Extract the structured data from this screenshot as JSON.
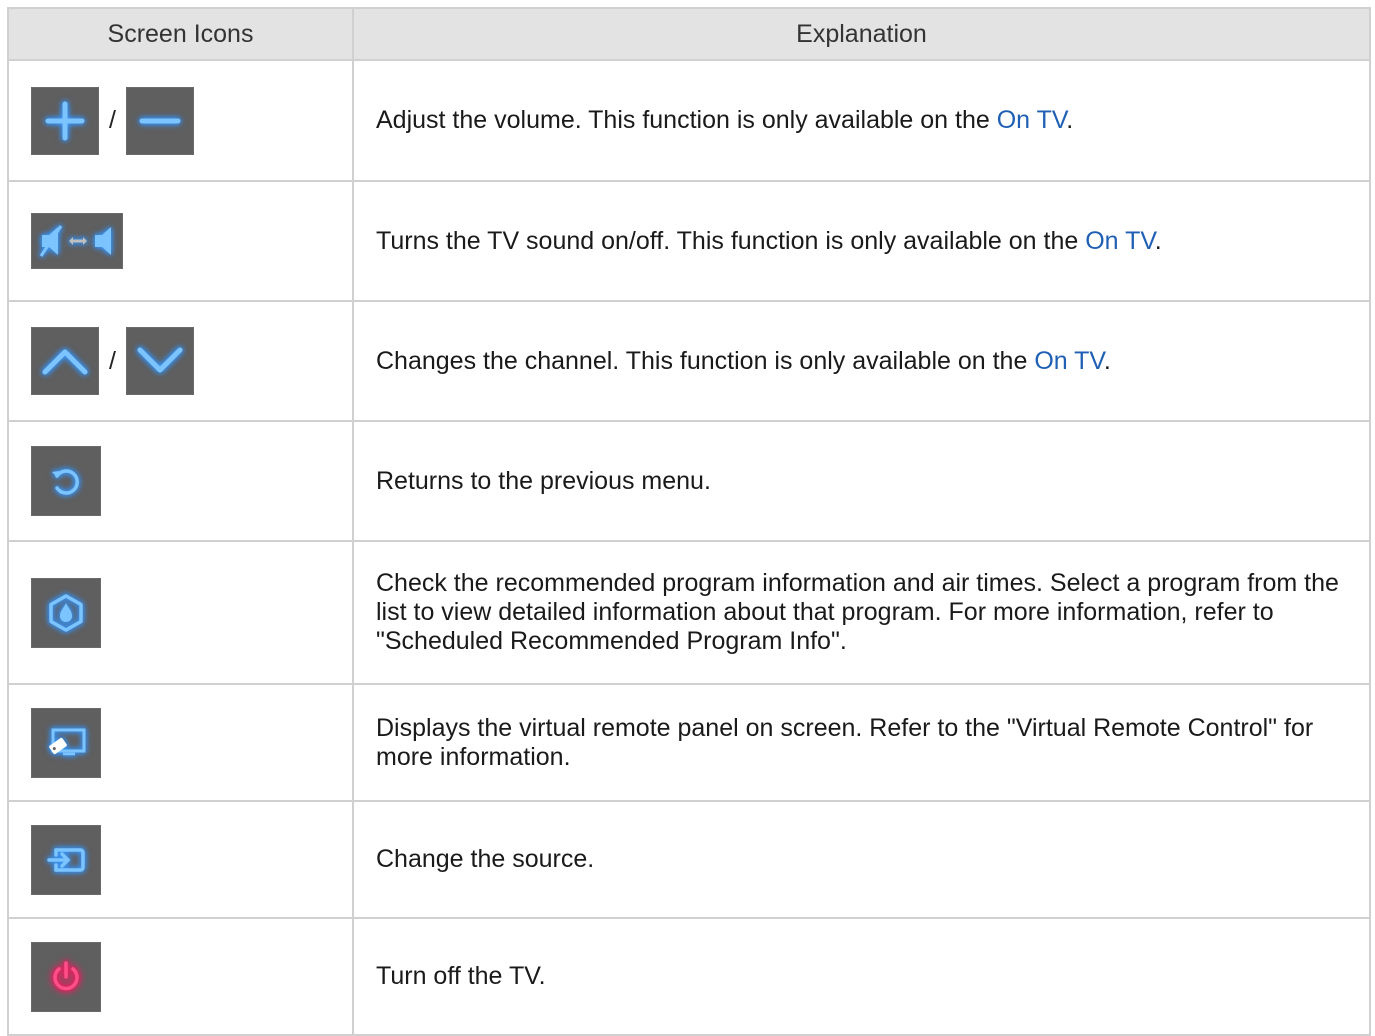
{
  "header": {
    "col_icons": "Screen Icons",
    "col_explanation": "Explanation"
  },
  "separator": "/",
  "rows": [
    {
      "icons": [
        "plus-icon",
        "minus-icon"
      ],
      "text": "Adjust the volume. This function is only available on the ",
      "link": "On TV",
      "suffix": "."
    },
    {
      "icons": [
        "mute-toggle-icon"
      ],
      "text": "Turns the TV sound on/off. This function is only available on the ",
      "link": "On TV",
      "suffix": "."
    },
    {
      "icons": [
        "chevron-up-icon",
        "chevron-down-icon"
      ],
      "text": "Changes the channel. This function is only available on the ",
      "link": "On TV",
      "suffix": "."
    },
    {
      "icons": [
        "return-icon"
      ],
      "text": "Returns to the previous menu."
    },
    {
      "icons": [
        "recommended-icon"
      ],
      "text": "Check the recommended program information and air times. Select a program from the list to view detailed information about that program. For more information, refer to \"Scheduled Recommended Program Info\"."
    },
    {
      "icons": [
        "virtual-remote-icon"
      ],
      "text": "Displays the virtual remote panel on screen. Refer to the \"Virtual Remote Control\" for more information."
    },
    {
      "icons": [
        "source-icon"
      ],
      "text": "Change the source."
    },
    {
      "icons": [
        "power-icon"
      ],
      "text": "Turn off the TV."
    }
  ],
  "colors": {
    "highlight": "#1f5fb4",
    "icon_glow": "#3fa0ff",
    "power_glow": "#ff2a6f",
    "button_bg": "#5f5f5f",
    "header_bg": "#e3e3e3"
  }
}
